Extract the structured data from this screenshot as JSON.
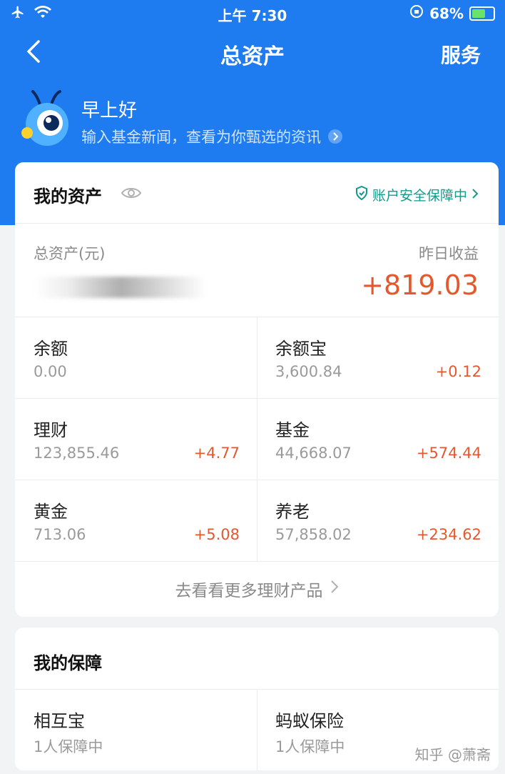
{
  "status_bar": {
    "time": "上午 7:30",
    "battery": "68%",
    "battery_level": 0.68
  },
  "nav": {
    "title": "总资产",
    "service_label": "服务"
  },
  "greeting": {
    "title": "早上好",
    "subtitle": "输入基金新闻，查看为你甄选的资讯"
  },
  "assets": {
    "title": "我的资产",
    "security_label": "账户安全保障中",
    "total_label": "总资产(元)",
    "yesterday_label": "昨日收益",
    "yesterday_value": "+819.03",
    "items": [
      {
        "name": "余额",
        "value": "0.00",
        "gain": ""
      },
      {
        "name": "余额宝",
        "value": "3,600.84",
        "gain": "+0.12"
      },
      {
        "name": "理财",
        "value": "123,855.46",
        "gain": "+4.77"
      },
      {
        "name": "基金",
        "value": "44,668.07",
        "gain": "+574.44"
      },
      {
        "name": "黄金",
        "value": "713.06",
        "gain": "+5.08"
      },
      {
        "name": "养老",
        "value": "57,858.02",
        "gain": "+234.62"
      }
    ],
    "more_label": "去看看更多理财产品"
  },
  "protection": {
    "title": "我的保障",
    "items": [
      {
        "name": "相互宝",
        "status": "1人保障中"
      },
      {
        "name": "蚂蚁保险",
        "status": "1人保障中"
      }
    ]
  },
  "watermark": "知乎 @萧斋",
  "colors": {
    "brand_blue": "#1e7bf0",
    "gain_red": "#e4582e",
    "security_teal": "#139a8a"
  }
}
